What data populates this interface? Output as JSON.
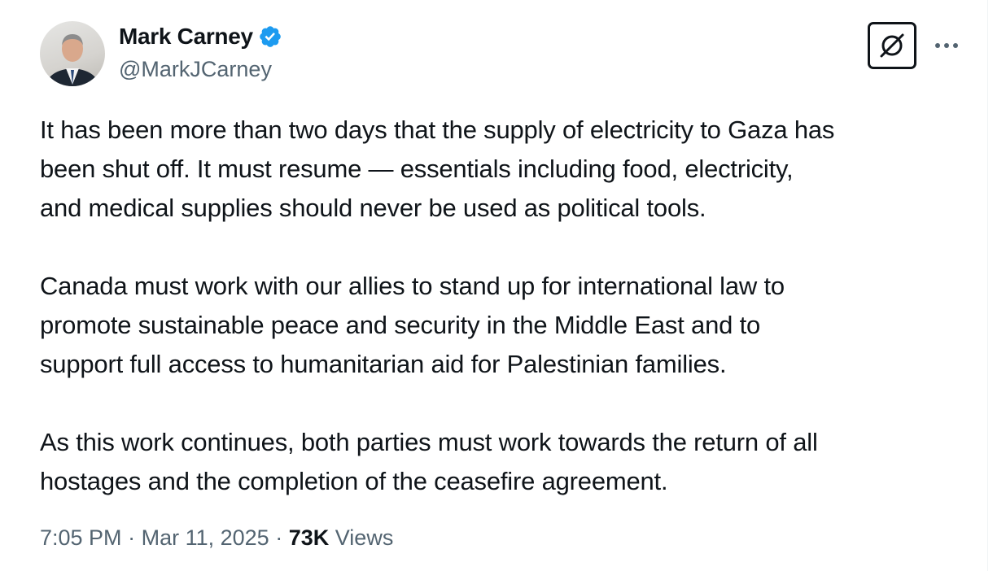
{
  "author": {
    "display_name": "Mark Carney",
    "handle": "@MarkJCarney",
    "verified": true,
    "verified_color": "#1d9bf0"
  },
  "header_actions": {
    "grok_icon": "grok-icon",
    "more_icon": "more-dots-icon"
  },
  "tweet": {
    "paragraphs": [
      [
        "It has been more than two days that the supply of electricity to Gaza has",
        "been shut off. It must resume — essentials including food, electricity,",
        "and medical supplies should never be used as political tools."
      ],
      [
        "Canada must work with our allies to stand up for international law to",
        "promote sustainable peace and security in the Middle East and to",
        "support full access to humanitarian aid for Palestinian families."
      ],
      [
        "As this work continues, both parties must work towards the return of all",
        "hostages and the completion of the ceasefire agreement."
      ]
    ]
  },
  "meta": {
    "time": "7:05 PM",
    "separator": "·",
    "date": "Mar 11, 2025",
    "views_count": "73K",
    "views_label": "Views"
  },
  "colors": {
    "text_primary": "#0f1419",
    "text_secondary": "#536471",
    "divider": "#eff3f4"
  }
}
